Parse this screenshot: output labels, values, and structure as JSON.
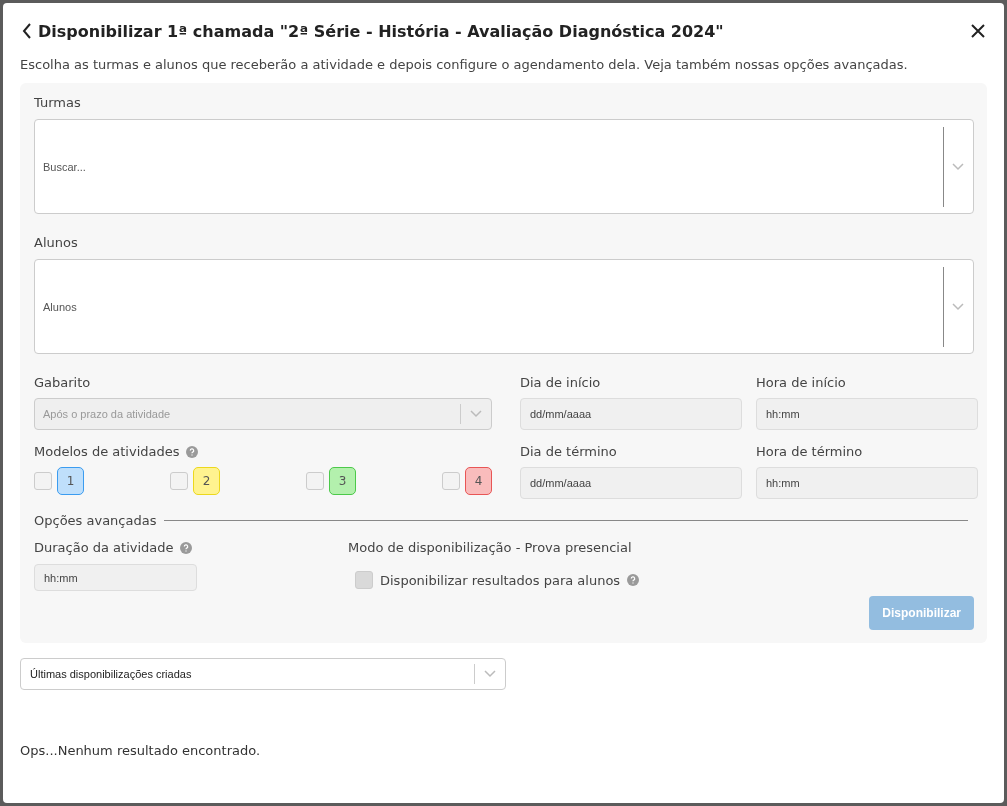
{
  "dialog": {
    "title": "Disponibilizar 1ª chamada \"2ª Série - História - Avaliação Diagnóstica 2024\"",
    "subtitle": "Escolha as turmas e alunos que receberão a atividade e depois configure o agendamento dela. Veja também nossas opções avançadas."
  },
  "turmas": {
    "label": "Turmas",
    "placeholder": "Buscar..."
  },
  "alunos": {
    "label": "Alunos",
    "placeholder": "Alunos"
  },
  "gabarito": {
    "label": "Gabarito",
    "value": "Após o prazo da atividade",
    "disabled": true
  },
  "dia_inicio": {
    "label": "Dia de início",
    "placeholder": "dd/mm/aaaa"
  },
  "hora_inicio": {
    "label": "Hora de início",
    "placeholder": "hh:mm"
  },
  "modelos": {
    "label": "Modelos de atividades",
    "items": [
      {
        "label": "1",
        "checked": false,
        "color": "#bfdffb"
      },
      {
        "label": "2",
        "checked": false,
        "color": "#fff38f"
      },
      {
        "label": "3",
        "checked": false,
        "color": "#b3f0ad"
      },
      {
        "label": "4",
        "checked": false,
        "color": "#f9bcbc"
      }
    ]
  },
  "dia_termino": {
    "label": "Dia de término",
    "placeholder": "dd/mm/aaaa"
  },
  "hora_termino": {
    "label": "Hora de término",
    "placeholder": "hh:mm"
  },
  "avancadas": {
    "title": "Opções avançadas",
    "duracao_label": "Duração da atividade",
    "duracao_placeholder": "hh:mm",
    "modo": "Modo de disponibilização - Prova presencial",
    "resultados": {
      "label": "Disponibilizar resultados para alunos",
      "checked": false
    }
  },
  "submit": {
    "label": "Disponibilizar",
    "disabled": true
  },
  "ultimas": {
    "value": "Últimas disponibilizações criadas"
  },
  "empty_message": "Ops...Nenhum resultado encontrado."
}
